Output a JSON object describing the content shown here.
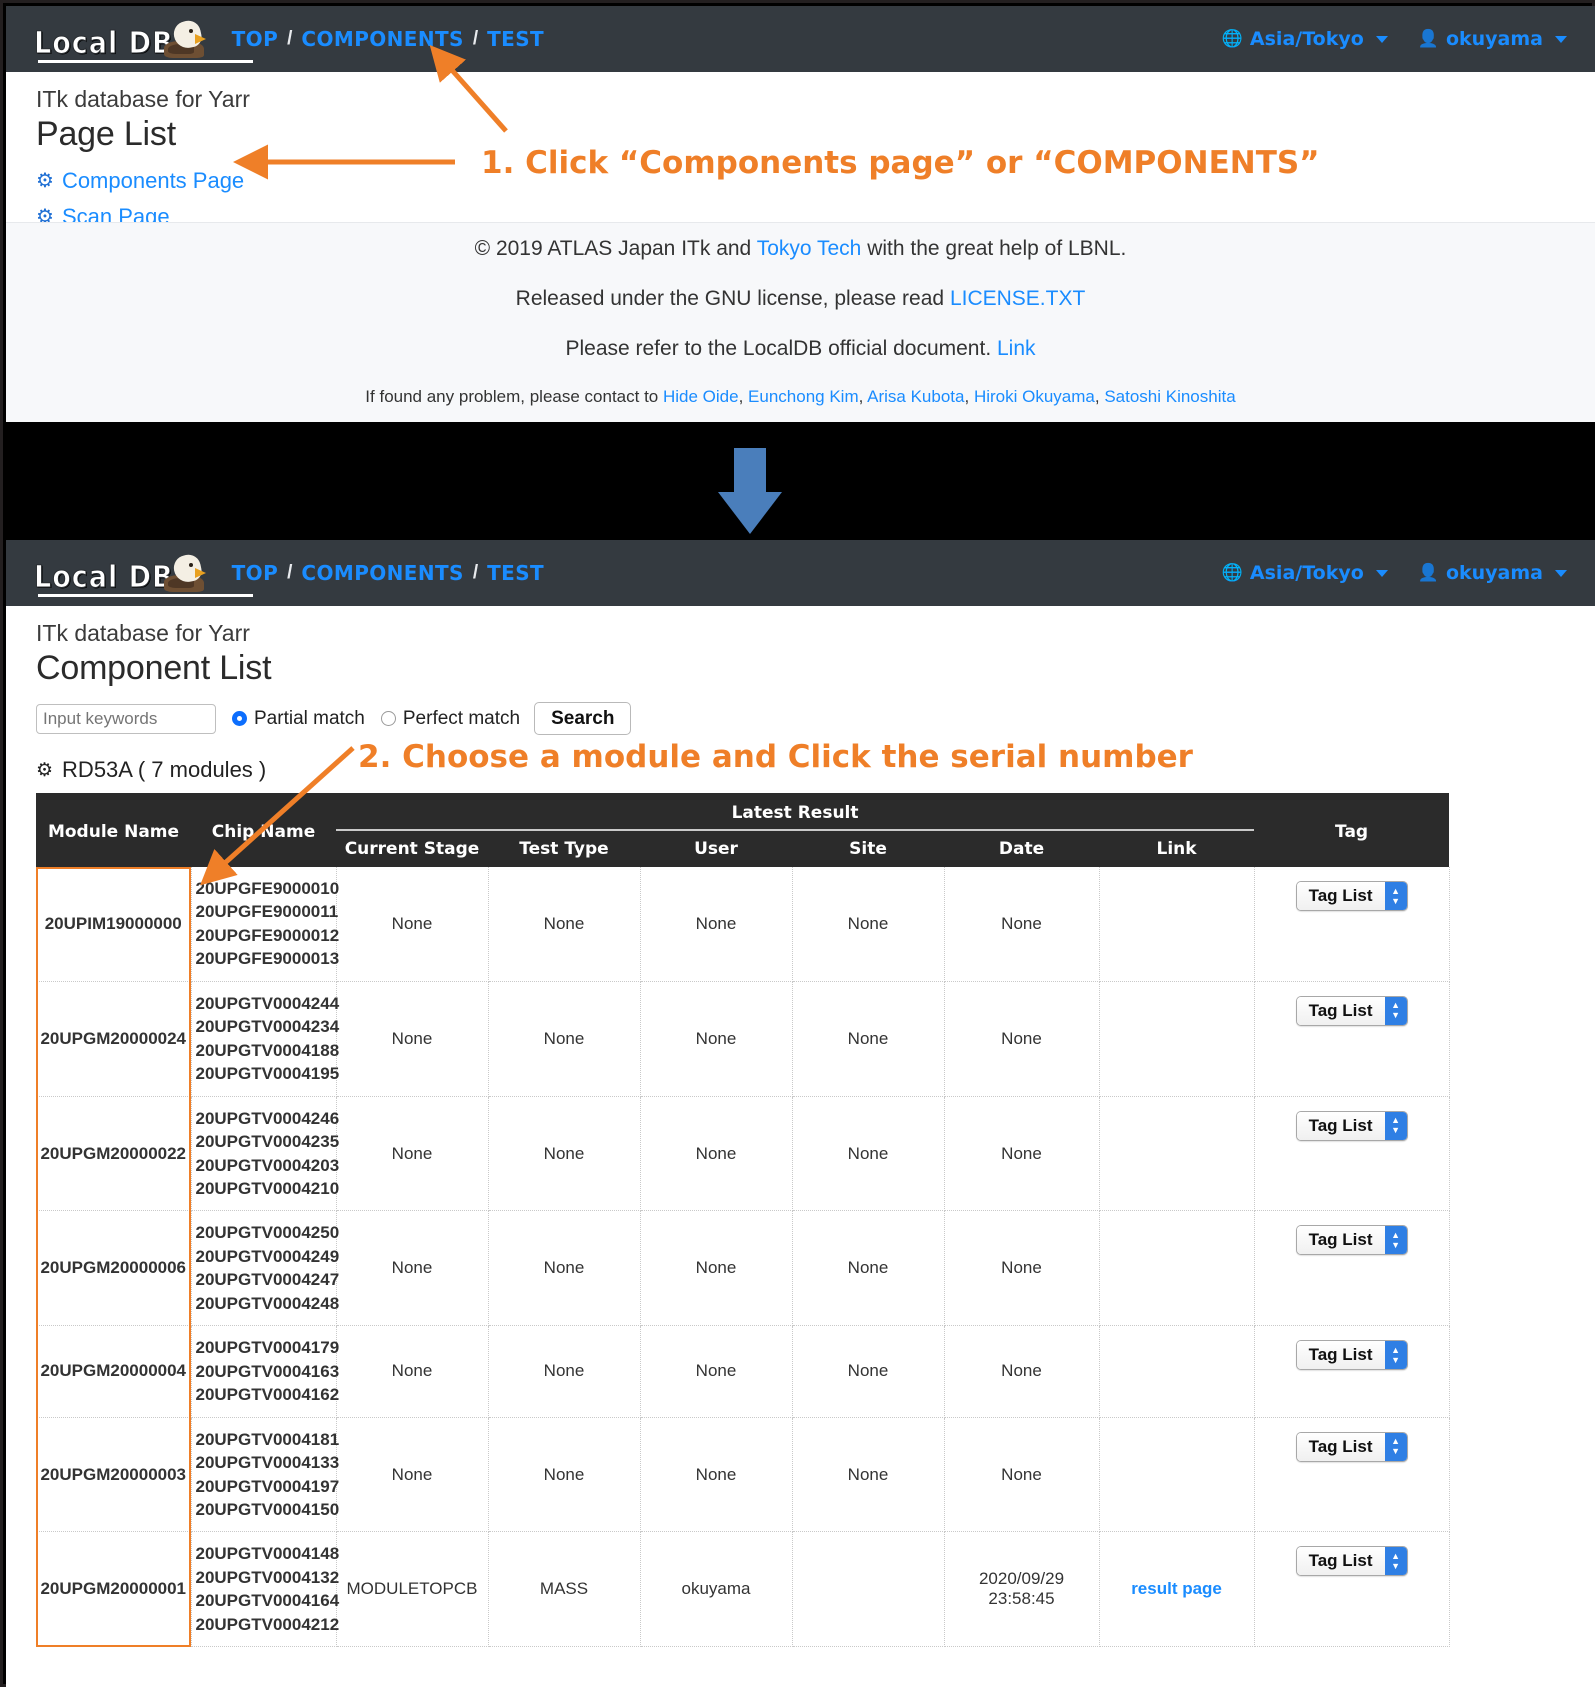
{
  "brand": {
    "name": "Local DB",
    "logo_alt": "localdb-eagle-logo"
  },
  "navbar": {
    "crumbs": [
      "TOP",
      "COMPONENTS",
      "TEST"
    ],
    "separator": "/",
    "timezone": "Asia/Tokyo",
    "user": "okuyama",
    "globe_icon": "globe-icon",
    "user_icon": "user-icon"
  },
  "panel1": {
    "subtitle": "ITk database for Yarr",
    "title": "Page List",
    "links": [
      {
        "label": "Components Page",
        "icon": "gear-icon"
      },
      {
        "label": "Scan Page",
        "icon": "gear-icon"
      }
    ],
    "footer": {
      "line1_pre": "© 2019 ATLAS Japan ITk and ",
      "line1_link": "Tokyo Tech",
      "line1_post": " with the great help of LBNL.",
      "line2_pre": "Released under the GNU license, please read ",
      "line2_link": "LICENSE.TXT",
      "line3_pre": "Please refer to the LocalDB official document. ",
      "line3_link": "Link",
      "line4_pre": "If found any problem, please contact to ",
      "contacts": [
        "Hide Oide",
        "Eunchong Kim",
        "Arisa Kubota",
        "Hiroki Okuyama",
        "Satoshi Kinoshita"
      ]
    }
  },
  "panel2": {
    "subtitle": "ITk database for Yarr",
    "title": "Component List",
    "search": {
      "placeholder": "Input keywords",
      "value": "",
      "partial_label": "Partial match",
      "perfect_label": "Perfect match",
      "selected": "Partial match",
      "button": "Search"
    },
    "group": {
      "icon": "gear-icon",
      "label": "RD53A ( 7 modules )"
    },
    "table": {
      "group_header": "Latest Result",
      "columns": [
        "Module Name",
        "Chip Name",
        "Current Stage",
        "Test Type",
        "User",
        "Site",
        "Date",
        "Link",
        "Tag"
      ],
      "tag_button_label": "Tag List",
      "rows": [
        {
          "module": "20UPIM19000000",
          "chips": [
            "20UPGFE9000010",
            "20UPGFE9000011",
            "20UPGFE9000012",
            "20UPGFE9000013"
          ],
          "stage": "None",
          "test_type": "None",
          "user": "None",
          "site": "None",
          "date": "None",
          "link": ""
        },
        {
          "module": "20UPGM20000024",
          "chips": [
            "20UPGTV0004244",
            "20UPGTV0004234",
            "20UPGTV0004188",
            "20UPGTV0004195"
          ],
          "stage": "None",
          "test_type": "None",
          "user": "None",
          "site": "None",
          "date": "None",
          "link": ""
        },
        {
          "module": "20UPGM20000022",
          "chips": [
            "20UPGTV0004246",
            "20UPGTV0004235",
            "20UPGTV0004203",
            "20UPGTV0004210"
          ],
          "stage": "None",
          "test_type": "None",
          "user": "None",
          "site": "None",
          "date": "None",
          "link": ""
        },
        {
          "module": "20UPGM20000006",
          "chips": [
            "20UPGTV0004250",
            "20UPGTV0004249",
            "20UPGTV0004247",
            "20UPGTV0004248"
          ],
          "stage": "None",
          "test_type": "None",
          "user": "None",
          "site": "None",
          "date": "None",
          "link": ""
        },
        {
          "module": "20UPGM20000004",
          "chips": [
            "20UPGTV0004179",
            "20UPGTV0004163",
            "20UPGTV0004162"
          ],
          "stage": "None",
          "test_type": "None",
          "user": "None",
          "site": "None",
          "date": "None",
          "link": ""
        },
        {
          "module": "20UPGM20000003",
          "chips": [
            "20UPGTV0004181",
            "20UPGTV0004133",
            "20UPGTV0004197",
            "20UPGTV0004150"
          ],
          "stage": "None",
          "test_type": "None",
          "user": "None",
          "site": "None",
          "date": "None",
          "link": ""
        },
        {
          "module": "20UPGM20000001",
          "chips": [
            "20UPGTV0004148",
            "20UPGTV0004132",
            "20UPGTV0004164",
            "20UPGTV0004212"
          ],
          "stage": "MODULETOPCB",
          "test_type": "MASS",
          "user": "okuyama",
          "site": "",
          "date": "2020/09/29\n23:58:45",
          "link": "result page"
        }
      ]
    }
  },
  "annotations": {
    "step1": "1. Click “Components page” or “COMPONENTS”",
    "step2": "2. Choose a module and Click the serial number",
    "color": "#ef7f28"
  }
}
